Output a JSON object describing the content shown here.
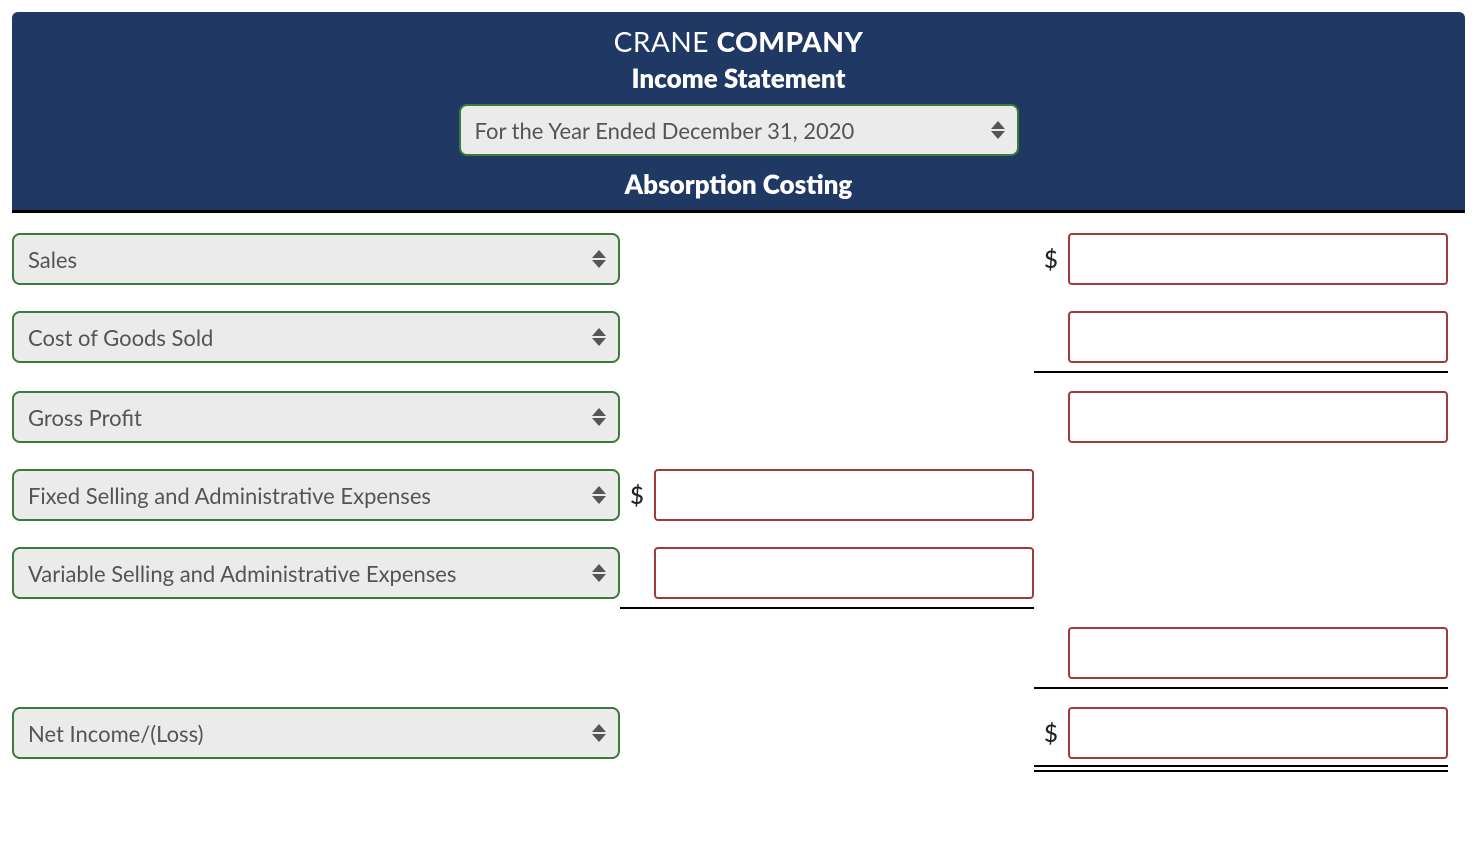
{
  "header": {
    "company_regular": "CRANE ",
    "company_bold": "COMPANY",
    "statement_title": "Income Statement",
    "period_selected": "For the Year Ended December 31, 2020",
    "costing_method": "Absorption Costing"
  },
  "rows": {
    "sales": {
      "label": "Sales",
      "currency": "$",
      "value": ""
    },
    "cogs": {
      "label": "Cost of Goods Sold",
      "value": ""
    },
    "gross_profit": {
      "label": "Gross Profit",
      "value": ""
    },
    "fixed_sga": {
      "label": "Fixed Selling and Administrative Expenses",
      "currency": "$",
      "value": ""
    },
    "variable_sga": {
      "label": "Variable Selling and Administrative Expenses",
      "value": ""
    },
    "total_sga": {
      "value": ""
    },
    "net_income": {
      "label": "Net Income/(Loss)",
      "currency": "$",
      "value": ""
    }
  }
}
